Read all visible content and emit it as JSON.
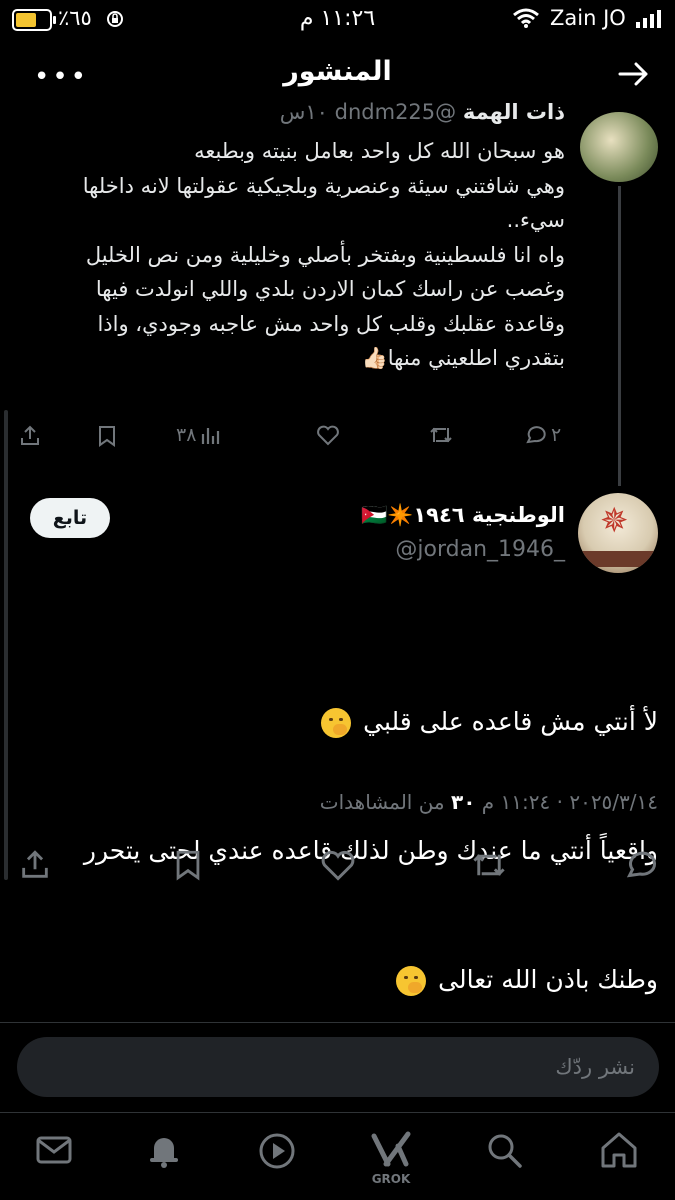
{
  "status_bar": {
    "time": "١١:٢٦ م",
    "carrier": "Zain JO",
    "battery_percent": "٪٦٥"
  },
  "header": {
    "title": "المنشور"
  },
  "previous_post": {
    "author_name": "ذات الهمة",
    "author_handle": "@dndm225",
    "time_ago": "١٠س",
    "text": "هو سبحان الله كل واحد بعامل بنيته وبطبعه\nوهي شافتني سيئة وعنصرية وبلجيكية عقولتها لانه داخلها سيء..\nواه انا فلسطينية وبفتخر بأصلي وخليلية ومن نص الخليل\nوغصب عن راسك كمان الاردن بلدي واللي انولدت فيها وقاعدة عقلبك وقلب كل واحد مش عاجبه وجودي، واذا بتقدري اطلعيني منها👍🏻",
    "reply_count": "٢",
    "view_count": "٣٨"
  },
  "main_post": {
    "author_name": "الوطنجية ١٩٤٦✴️🇯🇴",
    "author_handle": "@jordan_1946_",
    "follow_label": "تابع",
    "lines": [
      "لأ أنتي مش قاعده على قلبي",
      "واقعياً أنتي ما عندك وطن لذلك قاعده عندي لحتى يتحرر",
      "وطنك باذن الله تعالى"
    ],
    "emoji": "face-with-hand-over-mouth",
    "date": "٢٠٢٥/٣/١٤",
    "time": "١١:٢٤ م",
    "separator": "·",
    "views_count": "٣٠",
    "views_label": "من المشاهدات"
  },
  "reply_box": {
    "placeholder": "نشر ردّك"
  },
  "bottom_nav": {
    "grok_label": "GROK"
  },
  "colors": {
    "background": "#000000",
    "text": "#e7e9ea",
    "muted": "#71767b",
    "battery": "#f4c430"
  }
}
